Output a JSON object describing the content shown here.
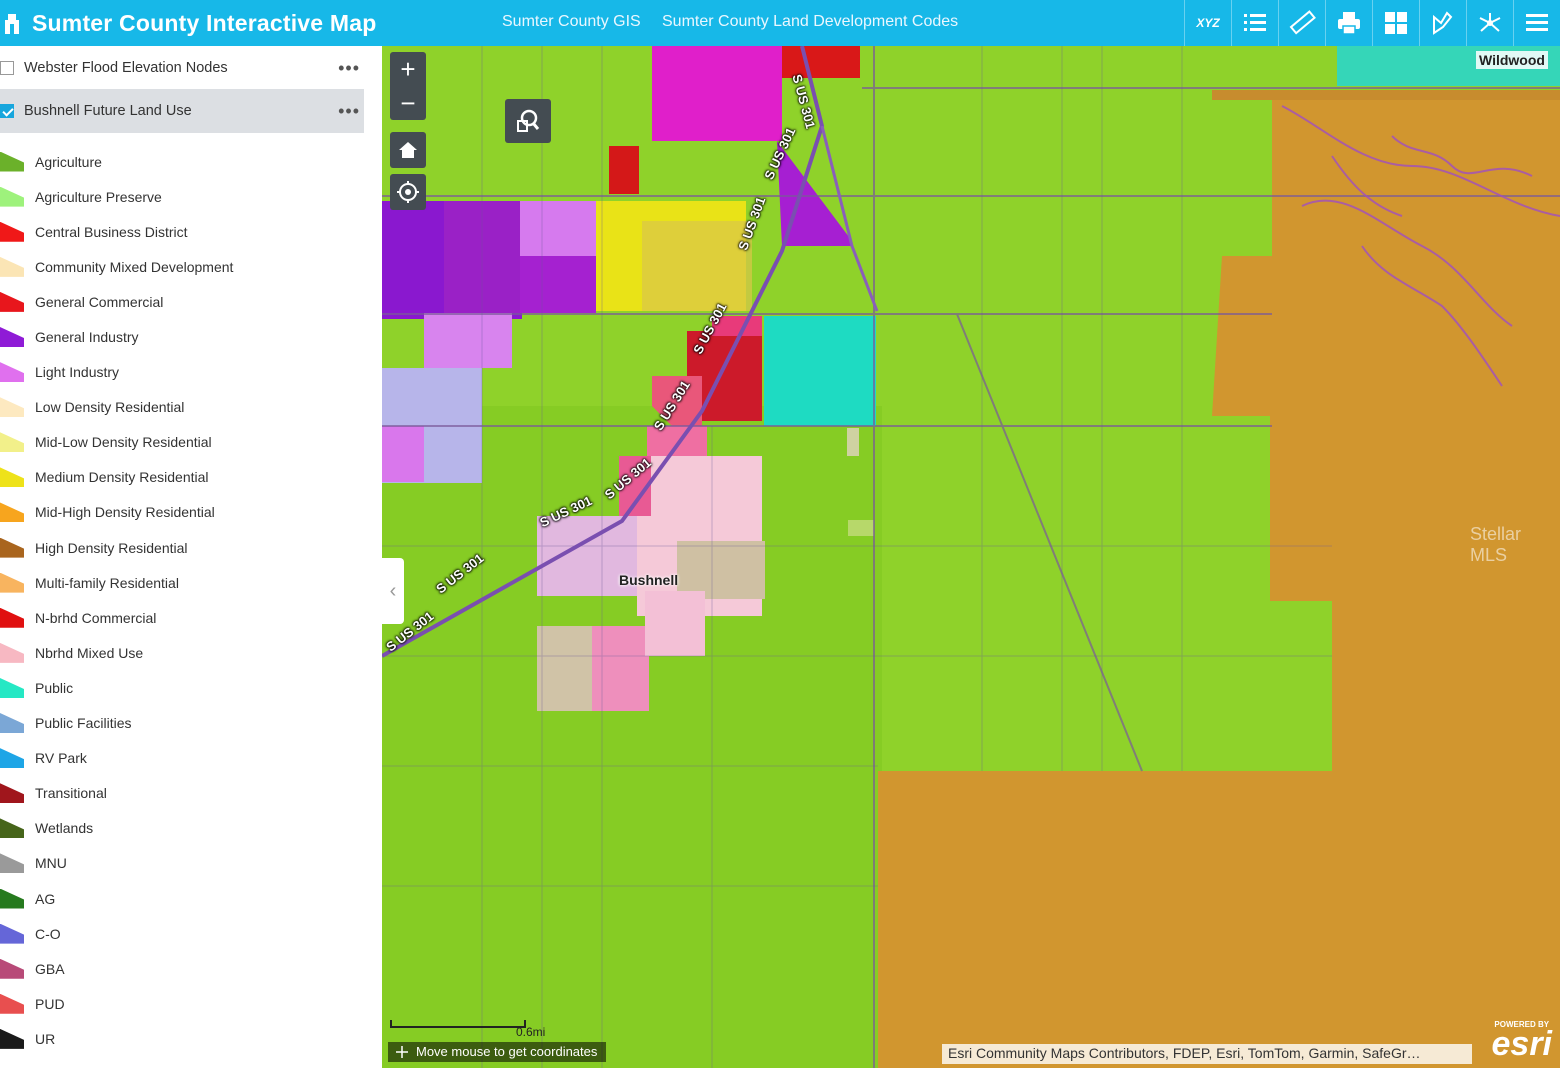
{
  "header": {
    "title": "Sumter County Interactive Map",
    "links": [
      "Sumter County GIS",
      "Sumter County Land Development Codes"
    ],
    "tools": [
      "xyz-coordinate-icon",
      "layer-list-icon",
      "measure-ruler-icon",
      "print-icon",
      "basemap-gallery-icon",
      "draw-icon",
      "share-icon",
      "menu-icon"
    ],
    "xyz_label": "XYZ"
  },
  "layers": [
    {
      "label": "Webster Flood Elevation Nodes",
      "checked": false,
      "more": "•••"
    },
    {
      "label": "Bushnell Future Land Use",
      "checked": true,
      "more": "•••"
    }
  ],
  "legend": [
    {
      "label": "Agriculture",
      "color": "#6bb12a"
    },
    {
      "label": "Agriculture Preserve",
      "color": "#9ef27c"
    },
    {
      "label": "Central Business District",
      "color": "#f01818"
    },
    {
      "label": "Community Mixed Development",
      "color": "#fbe5b5"
    },
    {
      "label": "General Commercial",
      "color": "#e8161c"
    },
    {
      "label": "General Industry",
      "color": "#8f1bd6"
    },
    {
      "label": "Light Industry",
      "color": "#e070ee"
    },
    {
      "label": "Low Density Residential",
      "color": "#fde9c0"
    },
    {
      "label": "Mid-Low Density Residential",
      "color": "#f2f08a"
    },
    {
      "label": "Medium Density Residential",
      "color": "#eee21a"
    },
    {
      "label": "Mid-High Density Residential",
      "color": "#f7a51e"
    },
    {
      "label": "High Density Residential",
      "color": "#a9651e"
    },
    {
      "label": "Multi-family Residential",
      "color": "#f8b45f"
    },
    {
      "label": "N-brhd Commercial",
      "color": "#e01010"
    },
    {
      "label": "Nbrhd Mixed Use",
      "color": "#f7b8c2"
    },
    {
      "label": "Public",
      "color": "#25e8c4"
    },
    {
      "label": "Public Facilities",
      "color": "#7ba7d6"
    },
    {
      "label": "RV Park",
      "color": "#1ea5e6"
    },
    {
      "label": "Transitional",
      "color": "#a0161c"
    },
    {
      "label": "Wetlands",
      "color": "#46651a"
    },
    {
      "label": "MNU",
      "color": "#9a9a9a"
    },
    {
      "label": "AG",
      "color": "#267a1e"
    },
    {
      "label": "C-O",
      "color": "#6566d8"
    },
    {
      "label": "GBA",
      "color": "#b84a78"
    },
    {
      "label": "PUD",
      "color": "#e84f4f"
    },
    {
      "label": "UR",
      "color": "#1a1a1a"
    }
  ],
  "map": {
    "zoom_in": "+",
    "zoom_out": "−",
    "city_label": "Wildwood",
    "town_label": "Bushnell",
    "road_label": "S US 301",
    "watermark": "Stellar MLS",
    "scale_label": "0.6mi",
    "coords_text": "Move mouse to get coordinates",
    "attribution": "Esri Community Maps Contributors, FDEP, Esri, TomTom, Garmin, SafeGr…",
    "esri_small": "POWERED BY",
    "esri_big": "esri",
    "collapse_glyph": "‹"
  }
}
